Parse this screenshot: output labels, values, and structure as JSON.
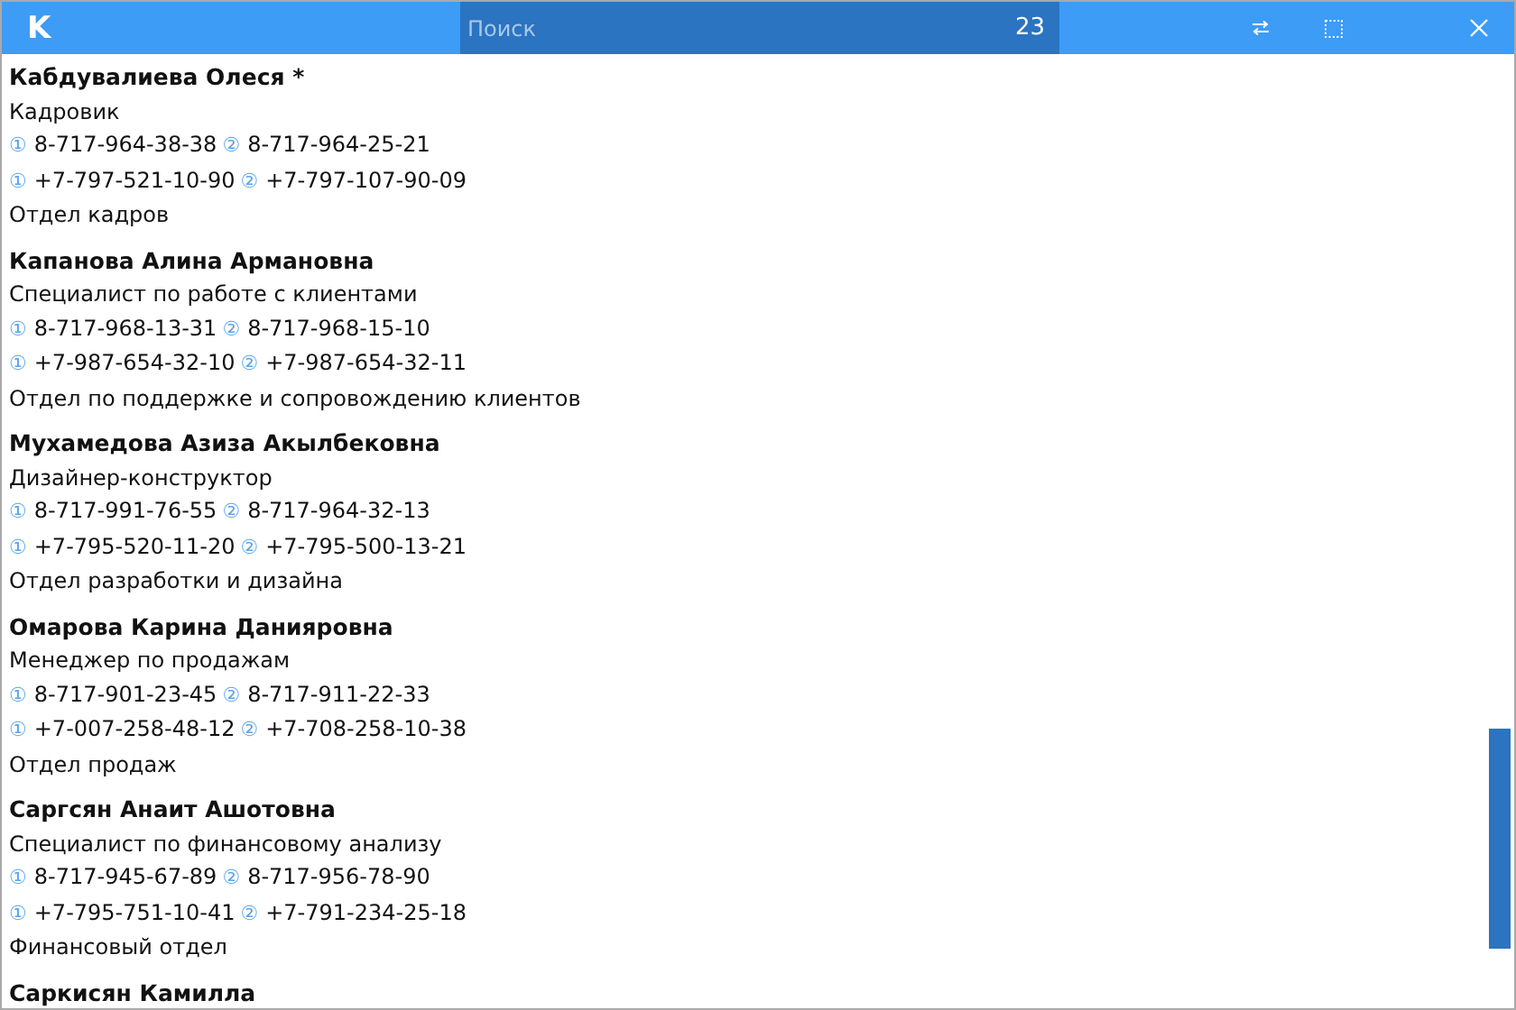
{
  "header": {
    "logo": "K",
    "search": {
      "placeholder": "Поиск",
      "count": "23"
    }
  },
  "contacts": [
    {
      "name": "Кабдувалиева Олеся *",
      "position": "Кадровик",
      "phone_rows": [
        [
          {
            "marker": "①",
            "number": "8-717-964-38-38"
          },
          {
            "marker": "②",
            "number": "8-717-964-25-21"
          }
        ],
        [
          {
            "marker": "①",
            "number": "+7-797-521-10-90"
          },
          {
            "marker": "②",
            "number": "+7-797-107-90-09"
          }
        ]
      ],
      "department": "Отдел кадров"
    },
    {
      "name": "Капанова Алина Армановна",
      "position": "Специалист по работе с клиентами",
      "phone_rows": [
        [
          {
            "marker": "①",
            "number": "8-717-968-13-31"
          },
          {
            "marker": "②",
            "number": "8-717-968-15-10"
          }
        ],
        [
          {
            "marker": "①",
            "number": "+7-987-654-32-10"
          },
          {
            "marker": "②",
            "number": "+7-987-654-32-11"
          }
        ]
      ],
      "department": "Отдел по поддержке и сопровождению клиентов"
    },
    {
      "name": "Мухамедова Азиза Акылбековна",
      "position": "Дизайнер-конструктор",
      "phone_rows": [
        [
          {
            "marker": "①",
            "number": "8-717-991-76-55"
          },
          {
            "marker": "②",
            "number": "8-717-964-32-13"
          }
        ],
        [
          {
            "marker": "①",
            "number": "+7-795-520-11-20"
          },
          {
            "marker": "②",
            "number": "+7-795-500-13-21"
          }
        ]
      ],
      "department": "Отдел разработки и дизайна"
    },
    {
      "name": "Омарова Карина Данияровна",
      "position": "Менеджер по продажам",
      "phone_rows": [
        [
          {
            "marker": "①",
            "number": "8-717-901-23-45"
          },
          {
            "marker": "②",
            "number": "8-717-911-22-33"
          }
        ],
        [
          {
            "marker": "①",
            "number": "+7-007-258-48-12"
          },
          {
            "marker": "②",
            "number": "+7-708-258-10-38"
          }
        ]
      ],
      "department": "Отдел продаж"
    },
    {
      "name": "Саргсян Анаит Ашотовна",
      "position": "Специалист по финансовому анализу",
      "phone_rows": [
        [
          {
            "marker": "①",
            "number": "8-717-945-67-89"
          },
          {
            "marker": "②",
            "number": "8-717-956-78-90"
          }
        ],
        [
          {
            "marker": "①",
            "number": "+7-795-751-10-41"
          },
          {
            "marker": "②",
            "number": "+7-791-234-25-18"
          }
        ]
      ],
      "department": "Финансовый отдел"
    },
    {
      "name": "Саркисян Камилла"
    }
  ]
}
